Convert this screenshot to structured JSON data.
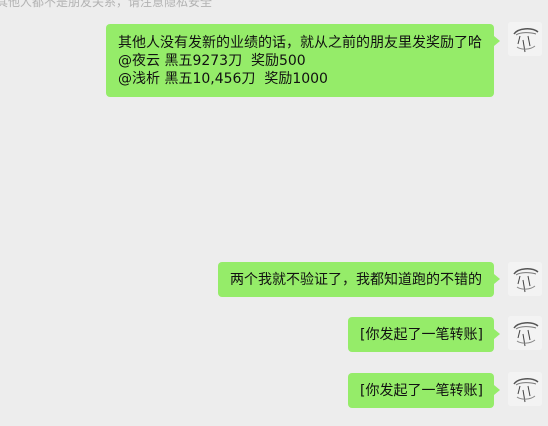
{
  "chat": {
    "top_notice": "其他人都不是朋友关系，请注意隐私安全",
    "messages": [
      {
        "text": "其他人没有发新的业绩的话，就从之前的朋友里发奖励了哈\n@夜云 黑五9273刀  奖励500\n@浅析 黑五10,456刀  奖励1000",
        "sender": "self"
      },
      {
        "text": "两个我就不验证了，我都知道跑的不错的",
        "sender": "self"
      },
      {
        "text": "[你发起了一笔转账]",
        "sender": "self"
      },
      {
        "text": "[你发起了一笔转账]",
        "sender": "self"
      }
    ],
    "bubble_color": "#95ec69",
    "background_color": "#ededed",
    "avatar_icon": "sketch-portrait-avatar"
  }
}
